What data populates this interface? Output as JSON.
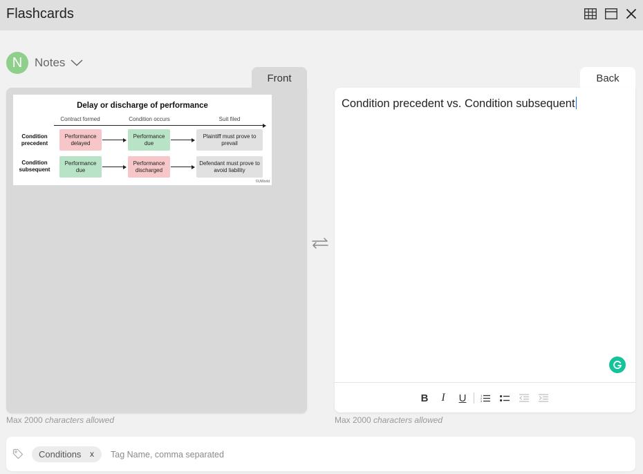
{
  "window": {
    "title": "Flashcards"
  },
  "deck": {
    "avatar_letter": "N",
    "name": "Notes"
  },
  "front": {
    "tab_label": "Front",
    "figure": {
      "title": "Delay or discharge of performance",
      "columns": [
        "Contract formed",
        "Condition occurs",
        "Suit filed"
      ],
      "rows": [
        {
          "label": "Condition precedent",
          "cells": [
            "Performance delayed",
            "Performance due",
            "Plaintiff must prove to prevail"
          ]
        },
        {
          "label": "Condition subsequent",
          "cells": [
            "Performance due",
            "Performance discharged",
            "Defendant must prove to avoid liability"
          ]
        }
      ],
      "credit": "©UWorld"
    },
    "max_note_number": "Max 2000",
    "max_note_text": "characters allowed"
  },
  "back": {
    "tab_label": "Back",
    "text": "Condition precedent vs. Condition subsequent",
    "max_note_number": "Max 2000",
    "max_note_text": "characters allowed",
    "toolbar": {
      "bold": "B",
      "italic": "I",
      "underline": "U"
    }
  },
  "tags": {
    "chips": [
      {
        "label": "Conditions",
        "remove": "x"
      }
    ],
    "input_placeholder": "Tag Name, comma separated"
  },
  "colors": {
    "avatar": "#8fcf8c",
    "grammarly": "#15c39a",
    "card_front_bg": "#d9d9d9",
    "caret": "#1a73e8"
  }
}
